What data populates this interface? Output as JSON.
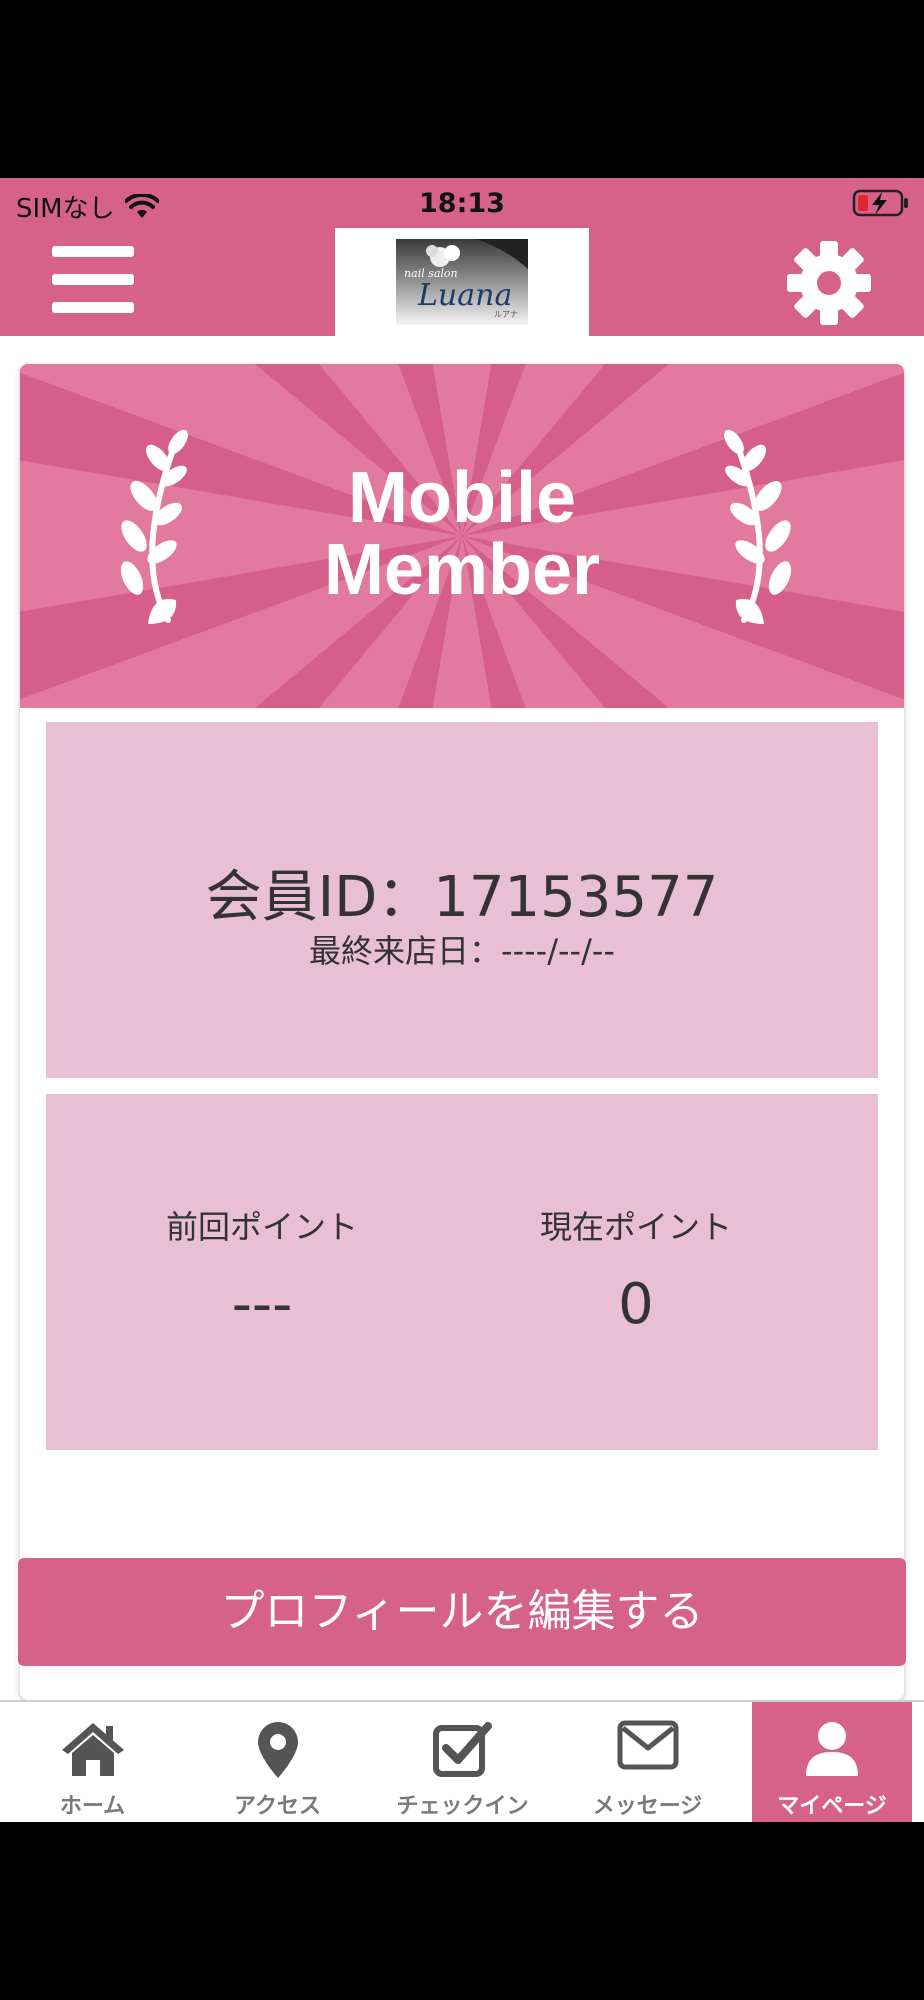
{
  "status_bar": {
    "carrier": "SIMなし",
    "time": "18:13"
  },
  "header": {
    "logo_text": "Luana",
    "logo_subtext": "nail salon",
    "logo_kana": "ルアナ"
  },
  "banner": {
    "line1": "Mobile",
    "line2": "Member"
  },
  "member": {
    "id_text": "会員ID：17153577",
    "last_visit_text": "最終来店日：----/--/--"
  },
  "points": {
    "previous_label": "前回ポイント",
    "previous_value": "---",
    "current_label": "現在ポイント",
    "current_value": "0"
  },
  "edit_profile_button": "プロフィールを編集する",
  "tabs": [
    {
      "label": "ホーム",
      "icon": "home-icon"
    },
    {
      "label": "アクセス",
      "icon": "map-pin-icon"
    },
    {
      "label": "チェックイン",
      "icon": "checkbox-icon"
    },
    {
      "label": "メッセージ",
      "icon": "envelope-icon"
    },
    {
      "label": "マイページ",
      "icon": "user-icon",
      "active": true
    }
  ],
  "colors": {
    "accent": "#d6628a",
    "panel": "#e9bfd3"
  }
}
